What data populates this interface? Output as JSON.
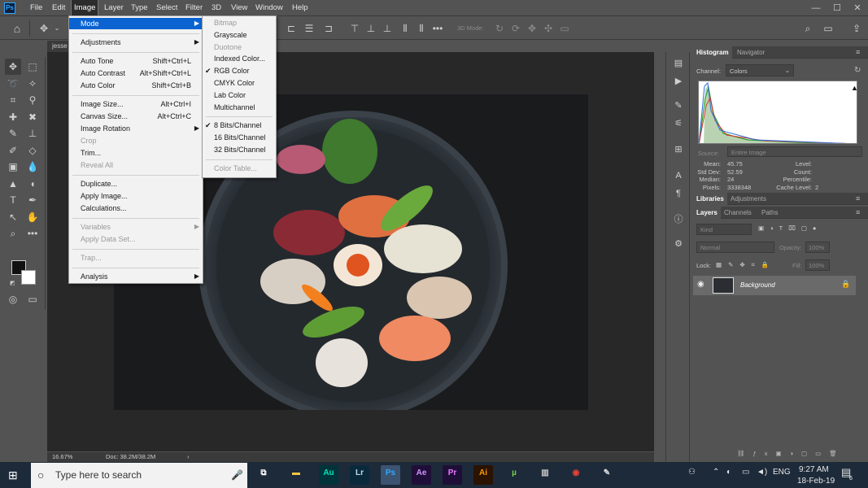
{
  "app": {
    "logo": "Ps"
  },
  "menubar": {
    "items": [
      "File",
      "Edit",
      "Image",
      "Layer",
      "Type",
      "Select",
      "Filter",
      "3D",
      "View",
      "Window",
      "Help"
    ],
    "active": "Image"
  },
  "window_controls": {
    "minimize": "—",
    "maximize": "☐",
    "close": "✕"
  },
  "options_bar": {
    "mode_3d_label": "3D Mode:"
  },
  "document": {
    "tab_title": "jesse"
  },
  "status": {
    "zoom": "16.67%",
    "doc": "Doc: 38.2M/38.2M"
  },
  "image_menu": {
    "items": [
      {
        "label": "Mode",
        "submenu": true,
        "highlight": true
      },
      {
        "sep": true
      },
      {
        "label": "Adjustments",
        "submenu": true
      },
      {
        "sep": true
      },
      {
        "label": "Auto Tone",
        "shortcut": "Shift+Ctrl+L"
      },
      {
        "label": "Auto Contrast",
        "shortcut": "Alt+Shift+Ctrl+L"
      },
      {
        "label": "Auto Color",
        "shortcut": "Shift+Ctrl+B"
      },
      {
        "sep": true
      },
      {
        "label": "Image Size...",
        "shortcut": "Alt+Ctrl+I"
      },
      {
        "label": "Canvas Size...",
        "shortcut": "Alt+Ctrl+C"
      },
      {
        "label": "Image Rotation",
        "submenu": true
      },
      {
        "label": "Crop",
        "disabled": true
      },
      {
        "label": "Trim..."
      },
      {
        "label": "Reveal All",
        "disabled": true
      },
      {
        "sep": true
      },
      {
        "label": "Duplicate..."
      },
      {
        "label": "Apply Image..."
      },
      {
        "label": "Calculations..."
      },
      {
        "sep": true
      },
      {
        "label": "Variables",
        "submenu": true,
        "disabled": true
      },
      {
        "label": "Apply Data Set...",
        "disabled": true
      },
      {
        "sep": true
      },
      {
        "label": "Trap...",
        "disabled": true
      },
      {
        "sep": true
      },
      {
        "label": "Analysis",
        "submenu": true
      }
    ]
  },
  "mode_menu": {
    "items": [
      {
        "label": "Bitmap",
        "disabled": true
      },
      {
        "label": "Grayscale"
      },
      {
        "label": "Duotone",
        "disabled": true
      },
      {
        "label": "Indexed Color..."
      },
      {
        "label": "RGB Color",
        "checked": true
      },
      {
        "label": "CMYK Color"
      },
      {
        "label": "Lab Color"
      },
      {
        "label": "Multichannel"
      },
      {
        "sep": true
      },
      {
        "label": "8 Bits/Channel",
        "checked": true
      },
      {
        "label": "16 Bits/Channel"
      },
      {
        "label": "32 Bits/Channel"
      },
      {
        "sep": true
      },
      {
        "label": "Color Table...",
        "disabled": true
      }
    ]
  },
  "histogram_panel": {
    "tabs": [
      "Histogram",
      "Navigator"
    ],
    "channel_label": "Channel:",
    "channel_value": "Colors",
    "source_label": "Source:",
    "source_value": "Entire Image",
    "stats_left": [
      {
        "label": "Mean:",
        "value": "45.75"
      },
      {
        "label": "Std Dev:",
        "value": "52.59"
      },
      {
        "label": "Median:",
        "value": "24"
      },
      {
        "label": "Pixels:",
        "value": "3338348"
      }
    ],
    "stats_right": [
      {
        "label": "Level:",
        "value": ""
      },
      {
        "label": "Count:",
        "value": ""
      },
      {
        "label": "Percentile:",
        "value": ""
      },
      {
        "label": "Cache Level:",
        "value": "2"
      }
    ]
  },
  "libraries_panel": {
    "tabs": [
      "Libraries",
      "Adjustments"
    ]
  },
  "layers_panel": {
    "tabs": [
      "Layers",
      "Channels",
      "Paths"
    ],
    "kind_placeholder": "Kind",
    "blend_mode": "Normal",
    "opacity_label": "Opacity:",
    "opacity_value": "100%",
    "lock_label": "Lock:",
    "fill_label": "Fill:",
    "fill_value": "100%",
    "layers": [
      {
        "name": "Background",
        "visible": true,
        "locked": true
      }
    ]
  },
  "taskbar": {
    "search_placeholder": "Type here to search",
    "apps": [
      {
        "name": "task-view",
        "text": "⧉",
        "color": "#1d2a3a",
        "fg": "#fff"
      },
      {
        "name": "file-explorer",
        "text": "▬",
        "color": "#1d2a3a",
        "fg": "#f4c542"
      },
      {
        "name": "audition",
        "text": "Au",
        "color": "#00343a",
        "fg": "#00e4bb"
      },
      {
        "name": "lightroom",
        "text": "Lr",
        "color": "#0a2a3c",
        "fg": "#b9d9f3"
      },
      {
        "name": "photoshop",
        "text": "Ps",
        "color": "#001c3a",
        "fg": "#31a8ff"
      },
      {
        "name": "after-effects",
        "text": "Ae",
        "color": "#1f0f38",
        "fg": "#d291ff"
      },
      {
        "name": "premiere",
        "text": "Pr",
        "color": "#1f0f38",
        "fg": "#ea77ff"
      },
      {
        "name": "illustrator",
        "text": "Ai",
        "color": "#2b1300",
        "fg": "#ff9a00"
      },
      {
        "name": "utorrent",
        "text": "µ",
        "color": "#1d2a3a",
        "fg": "#76d14a"
      },
      {
        "name": "library",
        "text": "▥",
        "color": "#1d2a3a",
        "fg": "#c9c9c9"
      },
      {
        "name": "chrome",
        "text": "◉",
        "color": "#1d2a3a",
        "fg": "#e94235"
      },
      {
        "name": "paint",
        "text": "✎",
        "color": "#1d2a3a",
        "fg": "#ddd"
      }
    ],
    "language": "ENG",
    "time": "9:27 AM",
    "date": "18-Feb-19",
    "notification_count": "6"
  }
}
